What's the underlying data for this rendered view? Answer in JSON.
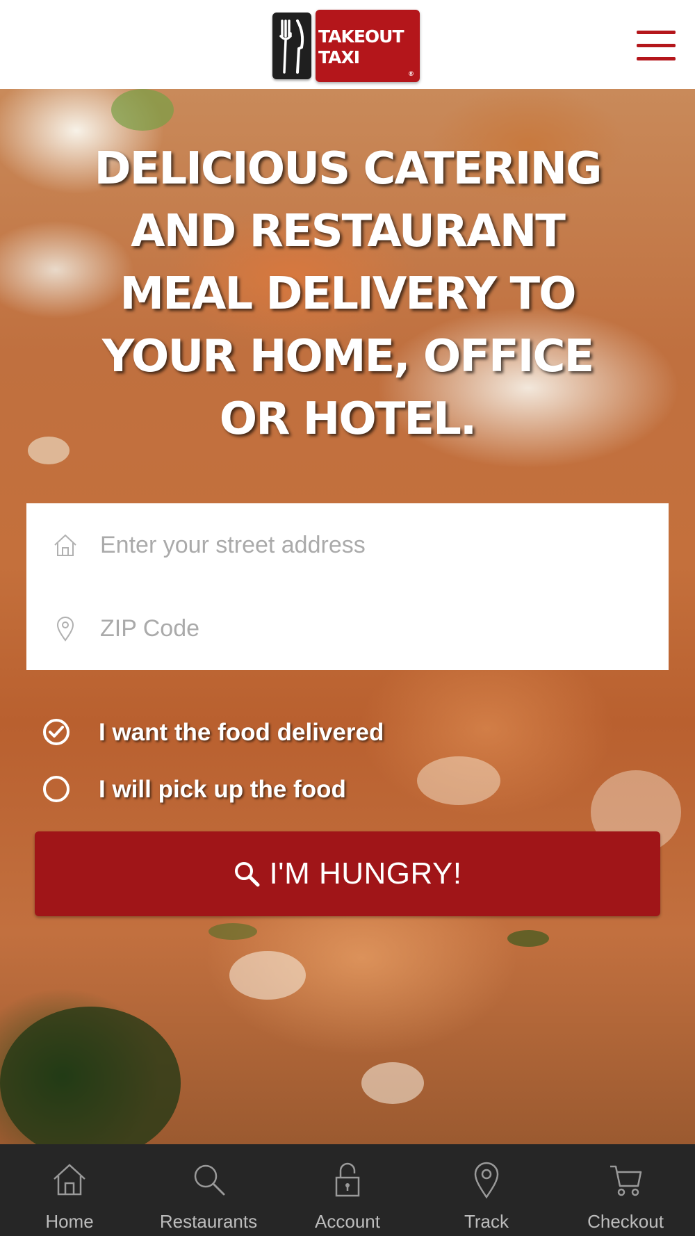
{
  "header": {
    "logo": {
      "line1": "TAKEOUT",
      "line2": "TAXI",
      "reg": "®"
    },
    "menu_icon": "hamburger-menu-icon"
  },
  "hero": {
    "title": "DELICIOUS CATERING AND RESTAURANT MEAL DELIVERY TO YOUR HOME, OFFICE OR HOTEL."
  },
  "form": {
    "address": {
      "placeholder": "Enter your street address",
      "value": "",
      "icon": "home-icon"
    },
    "zip": {
      "placeholder": "ZIP Code",
      "value": "",
      "icon": "map-pin-icon"
    }
  },
  "options": {
    "delivery": {
      "label": "I want the food delivered",
      "selected": true
    },
    "pickup": {
      "label": "I will pick up the food",
      "selected": false
    }
  },
  "cta": {
    "label": "I'M HUNGRY!",
    "icon": "search-icon"
  },
  "bottom_nav": {
    "items": [
      {
        "label": "Home",
        "icon": "home-icon"
      },
      {
        "label": "Restaurants",
        "icon": "search-icon"
      },
      {
        "label": "Account",
        "icon": "lock-icon"
      },
      {
        "label": "Track",
        "icon": "map-pin-icon"
      },
      {
        "label": "Checkout",
        "icon": "cart-icon"
      }
    ]
  },
  "colors": {
    "brand_red": "#a01518",
    "nav_bg": "#262626",
    "nav_text": "#bdbdbd"
  }
}
